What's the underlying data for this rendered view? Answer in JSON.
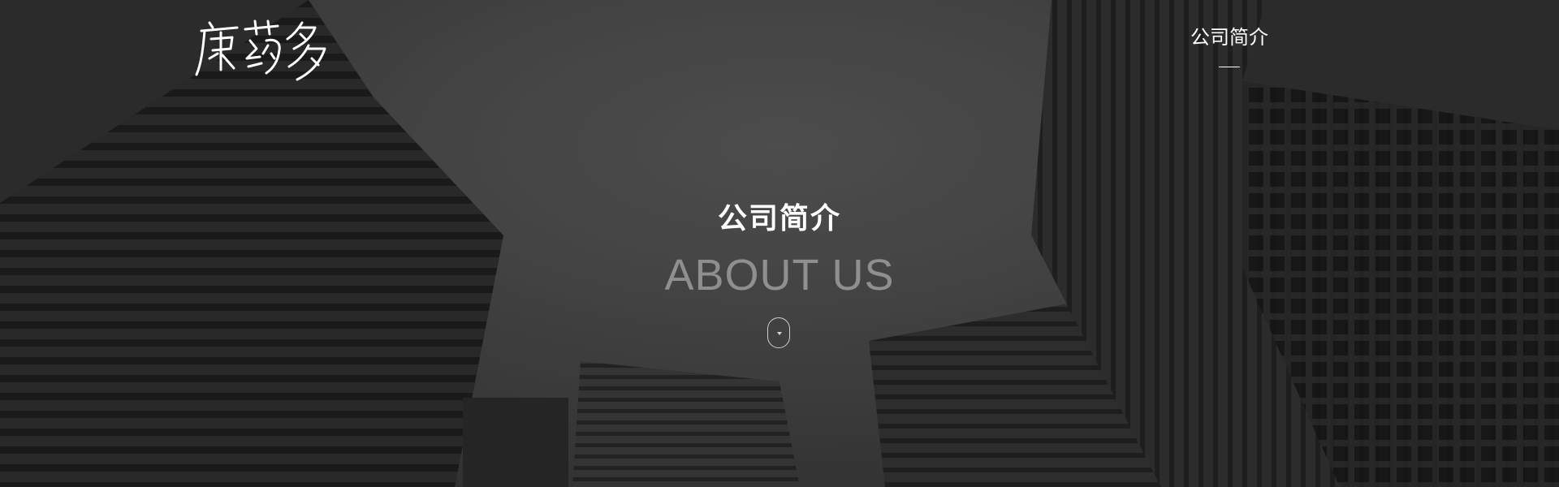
{
  "header": {
    "logo_text": "康药多",
    "nav": [
      {
        "label": "公司简介",
        "active": true
      }
    ]
  },
  "hero": {
    "title_cn": "公司简介",
    "title_en": "ABOUT US",
    "scroll_icon": "chevron-down-icon"
  },
  "colors": {
    "background": "#4a4a4a",
    "text_primary": "#ffffff",
    "text_secondary": "#8f8f8f"
  }
}
